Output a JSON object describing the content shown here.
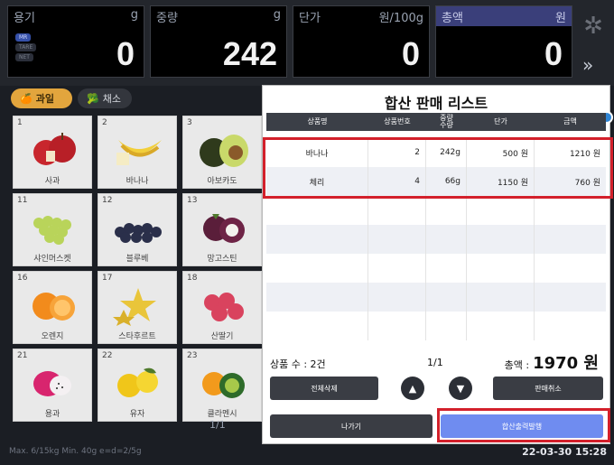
{
  "display": {
    "tare": {
      "label": "용기",
      "unit": "g",
      "value": "0",
      "badges": [
        "MR",
        "TARE",
        "NET"
      ]
    },
    "weight": {
      "label": "중량",
      "unit": "g",
      "value": "242"
    },
    "unit_price": {
      "label": "단가",
      "unit": "원/100g",
      "value": "0"
    },
    "total": {
      "label": "총액",
      "unit": "원",
      "value": "0"
    }
  },
  "categories": [
    {
      "label": "과일",
      "icon": "fruit-icon",
      "active": true
    },
    {
      "label": "채소",
      "icon": "vegetable-icon",
      "active": false
    }
  ],
  "products": [
    {
      "num": "1",
      "name": "사과",
      "icon": "apple-icon"
    },
    {
      "num": "2",
      "name": "바나나",
      "icon": "banana-icon"
    },
    {
      "num": "3",
      "name": "아보카도",
      "icon": "avocado-icon"
    },
    {
      "num": "11",
      "name": "샤인머스켓",
      "icon": "grape-icon"
    },
    {
      "num": "12",
      "name": "블루베",
      "icon": "blueberry-icon"
    },
    {
      "num": "13",
      "name": "망고스틴",
      "icon": "mangosteen-icon"
    },
    {
      "num": "16",
      "name": "오렌지",
      "icon": "orange-icon"
    },
    {
      "num": "17",
      "name": "스타후르트",
      "icon": "starfruit-icon"
    },
    {
      "num": "18",
      "name": "산딸기",
      "icon": "raspberry-icon"
    },
    {
      "num": "21",
      "name": "용과",
      "icon": "dragonfruit-icon"
    },
    {
      "num": "22",
      "name": "유자",
      "icon": "citron-icon"
    },
    {
      "num": "23",
      "name": "클라멘시",
      "icon": "clementine-icon"
    }
  ],
  "grid_pager": "1/1",
  "status": {
    "left": "Max. 6/15kg  Min. 40g  e=d=2/5g",
    "datetime": "22-03-30 15:28"
  },
  "modal": {
    "title": "합산 판매 리스트",
    "columns": [
      "상품명",
      "상품번호",
      "중량\n수량",
      "단가",
      "금액"
    ],
    "rows": [
      {
        "name": "바나나",
        "number": "2",
        "qty": "242g",
        "price": "500 원",
        "amount": "1210 원"
      },
      {
        "name": "체리",
        "number": "4",
        "qty": "66g",
        "price": "1150 원",
        "amount": "760 원"
      }
    ],
    "count_text": "상품 수 : 2건",
    "page": "1/1",
    "total_label": "총액 :",
    "total_value": "1970 원",
    "btn_delete_all": "전체삭제",
    "btn_cancel_sale": "판매취소",
    "btn_exit": "나가기",
    "btn_pay": "합산출력발행",
    "up_arrow": "▲",
    "down_arrow": "▼"
  },
  "colors": {
    "highlight": "#d3202b",
    "accent": "#6f8cf0",
    "category_active": "#e2a53d"
  }
}
